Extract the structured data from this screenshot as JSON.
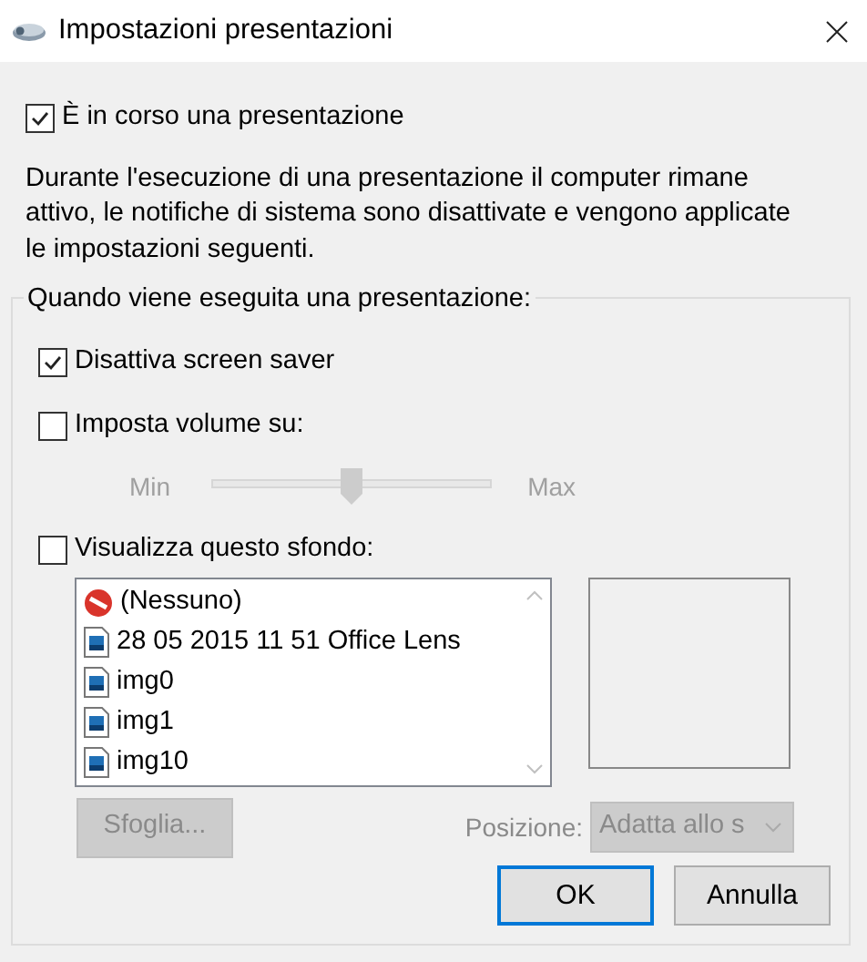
{
  "window": {
    "title": "Impostazioni presentazioni"
  },
  "presenting": {
    "label": "È in corso una presentazione",
    "checked": true
  },
  "description": "Durante l'esecuzione di una presentazione il computer rimane attivo, le notifiche di sistema sono disattivate e vengono applicate le impostazioni seguenti.",
  "group": {
    "title": "Quando viene eseguita una presentazione:",
    "screensaver": {
      "label": "Disattiva screen saver",
      "checked": true
    },
    "volume": {
      "label": "Imposta volume su:",
      "checked": false,
      "slider": {
        "min_label": "Min",
        "max_label": "Max",
        "level": 0.5,
        "disabled": true
      }
    },
    "background": {
      "label": "Visualizza questo sfondo:",
      "checked": false,
      "items": [
        {
          "kind": "none",
          "label": "(Nessuno)"
        },
        {
          "kind": "image",
          "label": "28 05 2015 11 51 Office Lens"
        },
        {
          "kind": "image",
          "label": "img0"
        },
        {
          "kind": "image",
          "label": "img1"
        },
        {
          "kind": "image",
          "label": "img10"
        }
      ],
      "browse": {
        "label": "Sfoglia...",
        "disabled": true
      },
      "position": {
        "label": "Posizione:",
        "value": "Adatta allo s",
        "disabled": true
      }
    }
  },
  "buttons": [
    {
      "label": "OK",
      "default": true
    },
    {
      "label": "Annulla",
      "default": false
    }
  ]
}
